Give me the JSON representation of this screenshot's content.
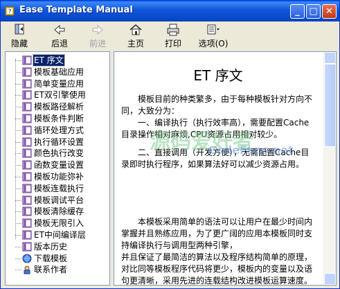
{
  "window": {
    "title": "Ease Template Manual",
    "minimize": "_",
    "maximize": "□",
    "close": "✕"
  },
  "toolbar": {
    "hide": "隐藏",
    "back": "后退",
    "forward": "前进",
    "home": "主页",
    "print": "打印",
    "options": "选项(O)"
  },
  "tree": {
    "items": [
      {
        "label": "ET 序文",
        "icon": "book-icon",
        "selected": true
      },
      {
        "label": "模板基础应用",
        "icon": "book-icon"
      },
      {
        "label": "简单变量应用",
        "icon": "book-icon"
      },
      {
        "label": "ET双引擎使用",
        "icon": "book-icon"
      },
      {
        "label": "模板路径解析",
        "icon": "book-icon"
      },
      {
        "label": "模板条件判断",
        "icon": "book-icon"
      },
      {
        "label": "循环处理方式",
        "icon": "book-icon"
      },
      {
        "label": "执行循环设置",
        "icon": "book-icon"
      },
      {
        "label": "颜色执行改变",
        "icon": "book-icon"
      },
      {
        "label": "函数变量设置",
        "icon": "book-icon"
      },
      {
        "label": "模板功能弥补",
        "icon": "book-icon"
      },
      {
        "label": "模板连载执行",
        "icon": "book-icon"
      },
      {
        "label": "模板调试平台",
        "icon": "book-icon"
      },
      {
        "label": "模板清除缓存",
        "icon": "book-icon"
      },
      {
        "label": "模板无限引入",
        "icon": "book-icon"
      },
      {
        "label": "ET中间编译层",
        "icon": "book-icon"
      },
      {
        "label": "版本历史",
        "icon": "book-icon"
      },
      {
        "label": "下载模板",
        "icon": "globe-icon"
      },
      {
        "label": "联系作者",
        "icon": "person-icon"
      }
    ]
  },
  "content": {
    "heading": "ET 序文",
    "p1": "模板目前的种类繁多，由于每种模板针对方向不同，大致分为：",
    "p2": "一、编译执行（执行效率高），需要配置Cache目录操作相对麻烦,CPU资源占用相对较少。",
    "p3": "二、直接调用（开发方便），无需配置Cache目录即时执行程序，如果算法好可以减少资源占用。",
    "p4": "本模板采用简单的语法可以让用户在最少时间内掌握并且熟练应用，为了更广阔的应用本模板同时支持编译执行与调用型两种引擎，",
    "p5": "并且保证了最简洁的算法以及程序结构简单的原理，对比同等模板程序代码将更少，模板内的变量以及语句更清晰，采用先进的连载结构改进模板运算速度。"
  },
  "watermark": {
    "text1": "源码爱好者",
    "text2": "CodeFans.net"
  }
}
